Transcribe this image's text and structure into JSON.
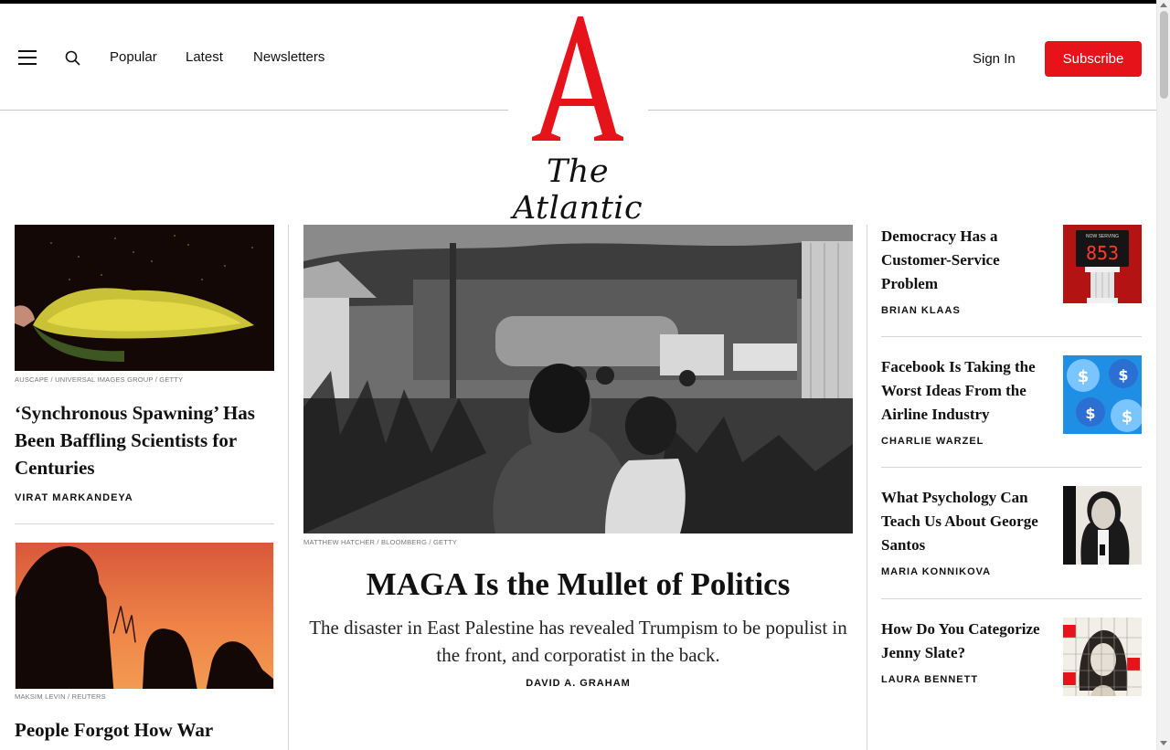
{
  "header": {
    "nav_links": [
      "Popular",
      "Latest",
      "Newsletters"
    ],
    "logo_letter": "A",
    "logo_wordmark": "The Atlantic",
    "sign_in_label": "Sign In",
    "subscribe_label": "Subscribe",
    "brand_color": "#e7131a"
  },
  "left_stories": [
    {
      "credit": "AUSCAPE / UNIVERSAL IMAGES GROUP / GETTY",
      "title": "‘Synchronous Spawning’ Has Been Baffling Scientists for Centuries",
      "byline": "VIRAT MARKANDEYA"
    },
    {
      "credit": "MAKSIM LEVIN / REUTERS",
      "title": "People Forgot How War Actually"
    }
  ],
  "main_story": {
    "credit": "MATTHEW HATCHER / BLOOMBERG / GETTY",
    "title": "MAGA Is the Mullet of Politics",
    "dek": "The disaster in East Palestine has revealed Trumpism to be populist in the front, and corporatist in the back.",
    "byline": "DAVID A. GRAHAM"
  },
  "right_stories": [
    {
      "title": "Democracy Has a Customer-Service Problem",
      "byline": "BRIAN KLAAS",
      "thumb_text": "853",
      "thumb_label": "NOW SERVING"
    },
    {
      "title": "Facebook Is Taking the Worst Ideas From the Airline Industry",
      "byline": "CHARLIE WARZEL"
    },
    {
      "title": "What Psychology Can Teach Us About George Santos",
      "byline": "MARIA KONNIKOVA"
    },
    {
      "title": "How Do You Categorize Jenny Slate?",
      "byline": "LAURA BENNETT"
    }
  ]
}
